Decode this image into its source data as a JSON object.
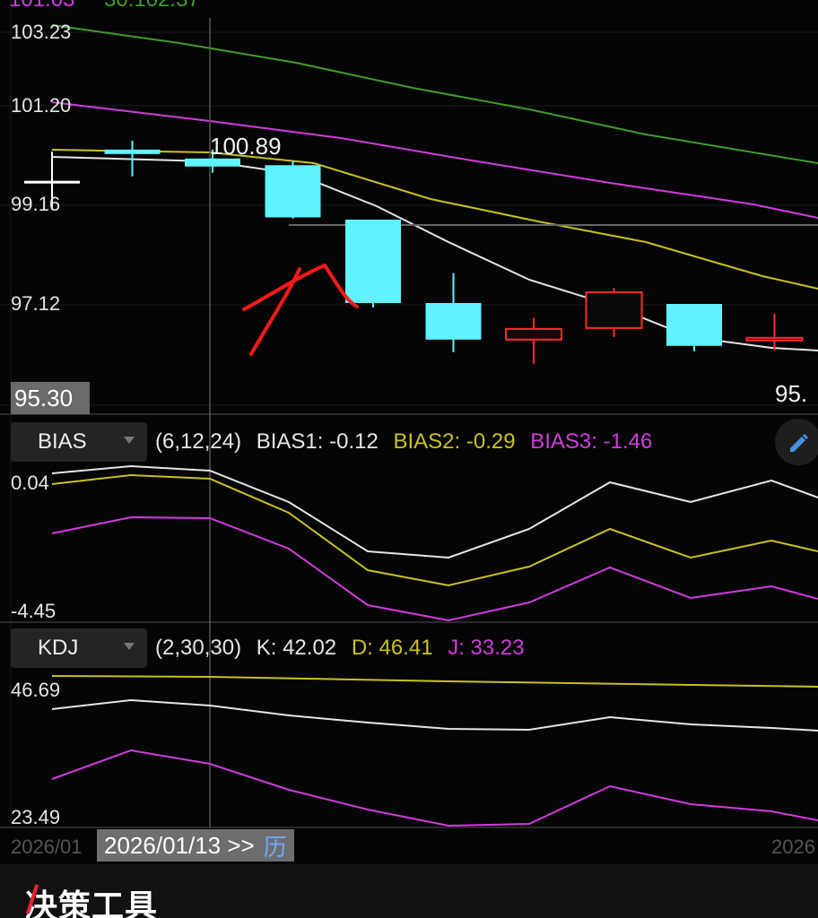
{
  "top_cut_text": {
    "left": "101.03",
    "right": "30:102.37"
  },
  "main": {
    "y_labels": [
      "103.23",
      "101.20",
      "99.16",
      "97.12"
    ],
    "low_label": "95.30",
    "high_label": "100.89",
    "right_cut_label": "95.",
    "candles": [
      {
        "open": 99.9,
        "close": 99.9,
        "high": 100.55,
        "low": 99.25,
        "dir": "flat"
      },
      {
        "open": 100.6,
        "close": 100.5,
        "high": 100.8,
        "low": 100.0,
        "dir": "down"
      },
      {
        "open": 100.4,
        "close": 100.22,
        "high": 100.6,
        "low": 100.08,
        "dir": "down"
      },
      {
        "open": 100.25,
        "close": 99.08,
        "high": 100.35,
        "low": 99.05,
        "dir": "down"
      },
      {
        "open": 99.03,
        "close": 97.16,
        "high": 99.03,
        "low": 97.06,
        "dir": "down"
      },
      {
        "open": 97.16,
        "close": 96.34,
        "high": 97.83,
        "low": 96.06,
        "dir": "down"
      },
      {
        "open": 96.34,
        "close": 96.58,
        "high": 96.83,
        "low": 95.8,
        "dir": "up"
      },
      {
        "open": 96.6,
        "close": 97.4,
        "high": 97.5,
        "low": 96.4,
        "dir": "up"
      },
      {
        "open": 97.14,
        "close": 96.2,
        "high": 97.14,
        "low": 96.08,
        "dir": "down"
      },
      {
        "open": 96.32,
        "close": 96.38,
        "high": 96.92,
        "low": 96.1,
        "dir": "up"
      }
    ]
  },
  "bias": {
    "selector": "BIAS",
    "params": "(6,12,24)",
    "bias1": "BIAS1: -0.12",
    "bias2": "BIAS2: -0.29",
    "bias3": "BIAS3: -1.46",
    "y_top": "0.04",
    "y_bottom": "-4.45"
  },
  "kdj": {
    "selector": "KDJ",
    "params": "(2,30,30)",
    "k": "K: 42.02",
    "d": "D: 46.41",
    "j": "J: 33.23",
    "y_top": "46.69",
    "y_bottom": "23.49"
  },
  "date_bar": {
    "left_faded": "2026/01",
    "selected": "2026/01/13 >>",
    "history_icon_text": "历",
    "right_faded": "2026"
  },
  "bottom_title": "决策工具",
  "colors": {
    "bull": "#ff2a2a",
    "bear": "#5ff2ff",
    "line_white": "#e6e6e6",
    "line_yellow": "#c8c21e",
    "line_magenta": "#d23be0",
    "line_green": "#3f9d2a"
  }
}
